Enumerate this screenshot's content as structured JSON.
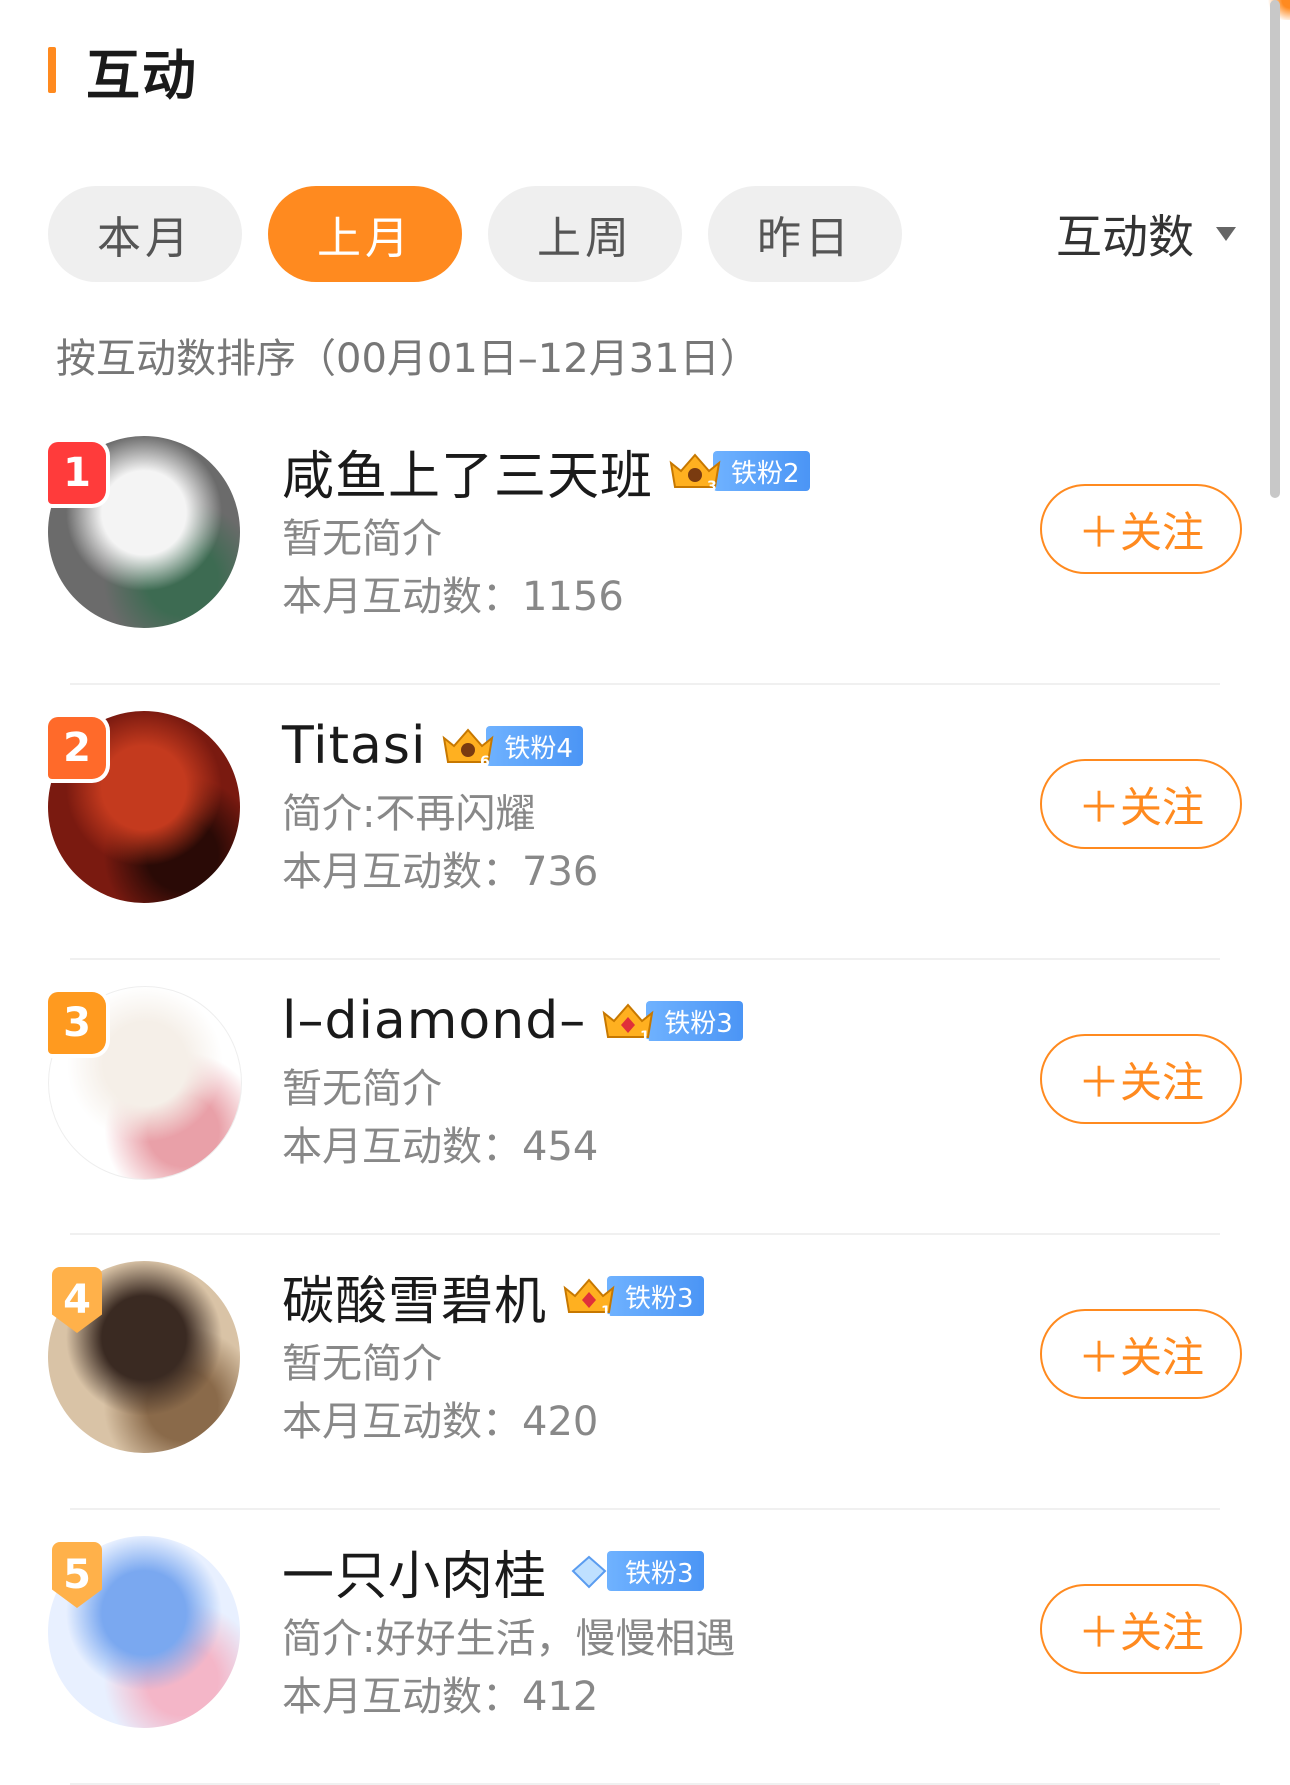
{
  "header": {
    "title": "互动"
  },
  "tabs": [
    {
      "label": "本月",
      "active": false
    },
    {
      "label": "上月",
      "active": true
    },
    {
      "label": "上周",
      "active": false
    },
    {
      "label": "昨日",
      "active": false
    }
  ],
  "sort": {
    "label": "互动数",
    "note": "按互动数排序（00月01日–12月31日）"
  },
  "follow_label": "＋关注",
  "users": [
    {
      "rank": "1",
      "name": "咸鱼上了三天班",
      "badge_level": "3",
      "badge": "铁粉2",
      "bio": "暂无简介",
      "count": "本月互动数：1156",
      "rank_color": "#ff3b3b",
      "avatar_colors": [
        "#6b6b6b",
        "#f4f4f4",
        "#3d6b52"
      ]
    },
    {
      "rank": "2",
      "name": "Titasi",
      "badge_level": "6",
      "badge": "铁粉4",
      "bio": "简介:不再闪耀",
      "count": "本月互动数：736",
      "rank_color": "#ff6a2a",
      "avatar_colors": [
        "#7a1a10",
        "#c43a1e",
        "#2a0a06"
      ]
    },
    {
      "rank": "3",
      "name": "l–diamond–",
      "badge_level": "1",
      "badge": "铁粉3",
      "bio": "暂无简介",
      "count": "本月互动数：454",
      "rank_color": "#ff9a1f",
      "avatar_colors": [
        "#ffffff",
        "#f5efe8",
        "#e9a0a8"
      ]
    },
    {
      "rank": "4",
      "name": "碳酸雪碧机",
      "badge_level": "1",
      "badge": "铁粉3",
      "bio": "暂无简介",
      "count": "本月互动数：420",
      "rank_color": "#ffb14a",
      "avatar_colors": [
        "#d9c3a6",
        "#3a2a22",
        "#8a6a4a"
      ]
    },
    {
      "rank": "5",
      "name": "一只小肉桂",
      "badge_level": "",
      "badge": "铁粉3",
      "bio": "简介:好好生活，慢慢相遇",
      "count": "本月互动数：412",
      "rank_color": "#ffb14a",
      "avatar_colors": [
        "#e8f0ff",
        "#7aa8f0",
        "#f4b6c8"
      ]
    }
  ]
}
